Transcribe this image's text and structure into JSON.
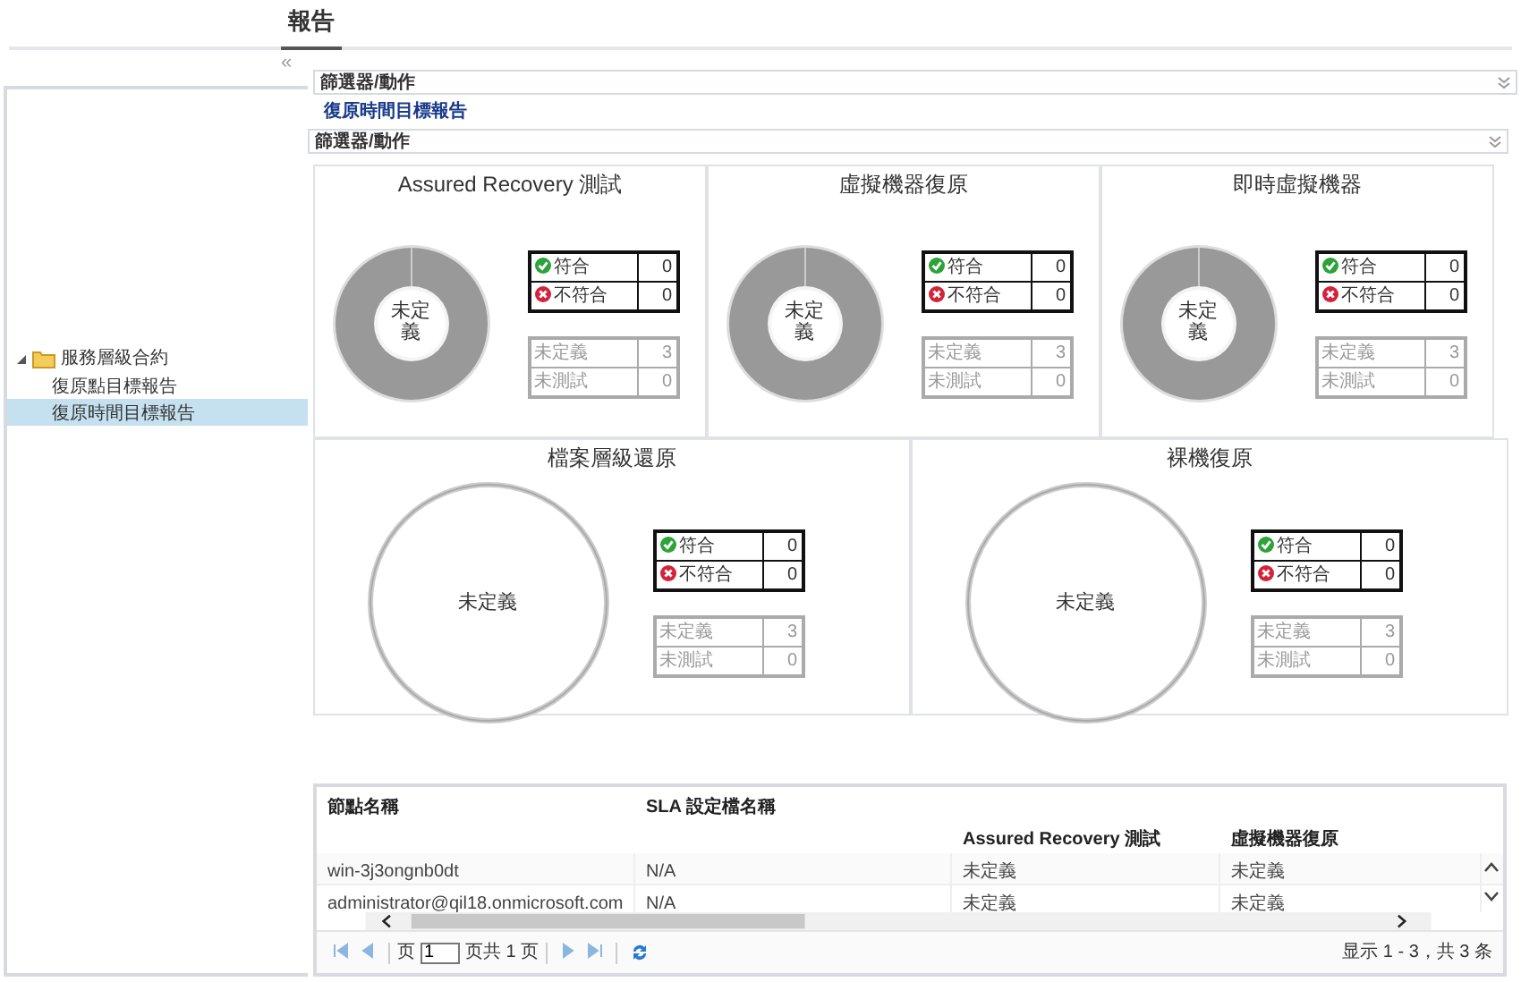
{
  "page_title": "報告",
  "sidebar": {
    "collapse_glyph": "«",
    "tree": [
      {
        "label": "服務層級合約",
        "expanded": true,
        "children": [
          {
            "label": "復原點目標報告",
            "selected": false
          },
          {
            "label": "復原時間目標報告",
            "selected": true
          }
        ]
      }
    ]
  },
  "filter_bar": {
    "label": "篩選器/動作"
  },
  "report_link": "復原時間目標報告",
  "report_filter_bar": {
    "label": "篩選器/動作"
  },
  "panels": [
    {
      "title": "Assured Recovery 測試",
      "kind": "donut",
      "center_label": "未定義",
      "legend": [
        {
          "kind": "ok",
          "label": "符合",
          "value": "0"
        },
        {
          "kind": "fail",
          "label": "不符合",
          "value": "0"
        }
      ],
      "stats": [
        {
          "label": "未定義",
          "value": "3"
        },
        {
          "label": "未測試",
          "value": "0"
        }
      ]
    },
    {
      "title": "虛擬機器復原",
      "kind": "donut",
      "center_label": "未定義",
      "legend": [
        {
          "kind": "ok",
          "label": "符合",
          "value": "0"
        },
        {
          "kind": "fail",
          "label": "不符合",
          "value": "0"
        }
      ],
      "stats": [
        {
          "label": "未定義",
          "value": "3"
        },
        {
          "label": "未測試",
          "value": "0"
        }
      ]
    },
    {
      "title": "即時虛擬機器",
      "kind": "donut",
      "center_label": "未定義",
      "legend": [
        {
          "kind": "ok",
          "label": "符合",
          "value": "0"
        },
        {
          "kind": "fail",
          "label": "不符合",
          "value": "0"
        }
      ],
      "stats": [
        {
          "label": "未定義",
          "value": "3"
        },
        {
          "label": "未測試",
          "value": "0"
        }
      ]
    },
    {
      "title": "檔案層級還原",
      "kind": "empty",
      "center_label": "未定義",
      "legend": [
        {
          "kind": "ok",
          "label": "符合",
          "value": "0"
        },
        {
          "kind": "fail",
          "label": "不符合",
          "value": "0"
        }
      ],
      "stats": [
        {
          "label": "未定義",
          "value": "3"
        },
        {
          "label": "未測試",
          "value": "0"
        }
      ]
    },
    {
      "title": "裸機復原",
      "kind": "empty",
      "center_label": "未定義",
      "legend": [
        {
          "kind": "ok",
          "label": "符合",
          "value": "0"
        },
        {
          "kind": "fail",
          "label": "不符合",
          "value": "0"
        }
      ],
      "stats": [
        {
          "label": "未定義",
          "value": "3"
        },
        {
          "label": "未測試",
          "value": "0"
        }
      ]
    }
  ],
  "table": {
    "columns": [
      {
        "label": "節點名稱",
        "kind": "top"
      },
      {
        "label": "SLA 設定檔名稱",
        "kind": "top"
      },
      {
        "label": "Assured Recovery 測試",
        "kind": "sub"
      },
      {
        "label": "虛擬機器復原",
        "kind": "sub"
      }
    ],
    "rows": [
      [
        "win-3j3ongnb0dt",
        "N/A",
        "未定義",
        "未定義"
      ],
      [
        "administrator@qil18.onmicrosoft.com",
        "N/A",
        "未定義",
        "未定義"
      ]
    ]
  },
  "pager": {
    "page_label": "页",
    "page_value": "1",
    "page_total": "页共 1 页",
    "summary": "显示 1 - 3，共 3 条"
  }
}
